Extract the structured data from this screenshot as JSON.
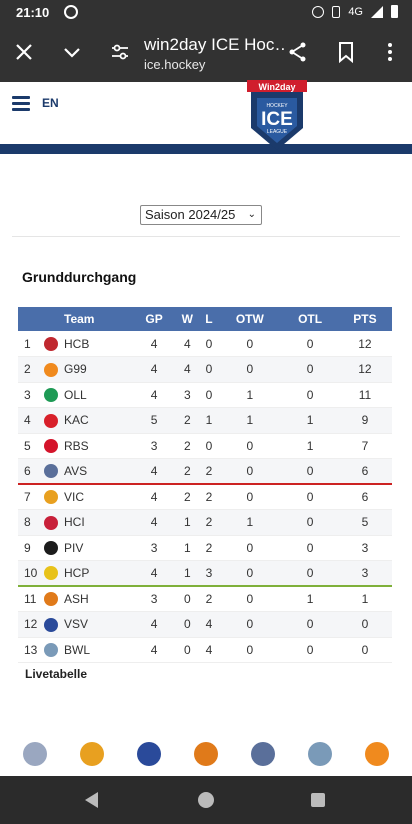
{
  "status_bar": {
    "time": "21:10",
    "network": "4G"
  },
  "browser": {
    "title": "win2day ICE Hoc…",
    "url": "ice.hockey",
    "icons": [
      "close-icon",
      "chevron-down-icon",
      "tune-icon",
      "share-icon",
      "bookmark-icon",
      "more-vert-icon"
    ]
  },
  "site": {
    "lang": "EN",
    "logo_top": "Win2day",
    "logo_sub1": "HOCKEY",
    "logo_main": "ICE",
    "logo_sub2": "LEAGUE"
  },
  "season_select": {
    "value": "Saison 2024/25"
  },
  "section_title": "Grunddurchgang",
  "table": {
    "headers": [
      "Team",
      "GP",
      "W",
      "L",
      "OTW",
      "OTL",
      "PTS"
    ],
    "rows": [
      {
        "pos": "1",
        "team": "HCB",
        "gp": "4",
        "w": "4",
        "l": "0",
        "otw": "0",
        "otl": "0",
        "pts": "12",
        "color": "#c0282f"
      },
      {
        "pos": "2",
        "team": "G99",
        "gp": "4",
        "w": "4",
        "l": "0",
        "otw": "0",
        "otl": "0",
        "pts": "12",
        "color": "#f08a1e"
      },
      {
        "pos": "3",
        "team": "OLL",
        "gp": "4",
        "w": "3",
        "l": "0",
        "otw": "1",
        "otl": "0",
        "pts": "11",
        "color": "#1e9a55"
      },
      {
        "pos": "4",
        "team": "KAC",
        "gp": "5",
        "w": "2",
        "l": "1",
        "otw": "1",
        "otl": "1",
        "pts": "9",
        "color": "#d8202a"
      },
      {
        "pos": "5",
        "team": "RBS",
        "gp": "3",
        "w": "2",
        "l": "0",
        "otw": "0",
        "otl": "1",
        "pts": "7",
        "color": "#d4142b"
      },
      {
        "pos": "6",
        "team": "AVS",
        "gp": "4",
        "w": "2",
        "l": "2",
        "otw": "0",
        "otl": "0",
        "pts": "6",
        "color": "#5a6f9a"
      },
      {
        "pos": "7",
        "team": "VIC",
        "gp": "4",
        "w": "2",
        "l": "2",
        "otw": "0",
        "otl": "0",
        "pts": "6",
        "color": "#e8a020"
      },
      {
        "pos": "8",
        "team": "HCI",
        "gp": "4",
        "w": "1",
        "l": "2",
        "otw": "1",
        "otl": "0",
        "pts": "5",
        "color": "#c8203a"
      },
      {
        "pos": "9",
        "team": "PIV",
        "gp": "3",
        "w": "1",
        "l": "2",
        "otw": "0",
        "otl": "0",
        "pts": "3",
        "color": "#1c1c1c"
      },
      {
        "pos": "10",
        "team": "HCP",
        "gp": "4",
        "w": "1",
        "l": "3",
        "otw": "0",
        "otl": "0",
        "pts": "3",
        "color": "#e8c21a"
      },
      {
        "pos": "11",
        "team": "ASH",
        "gp": "3",
        "w": "0",
        "l": "2",
        "otw": "0",
        "otl": "1",
        "pts": "1",
        "color": "#e07a1a"
      },
      {
        "pos": "12",
        "team": "VSV",
        "gp": "4",
        "w": "0",
        "l": "4",
        "otw": "0",
        "otl": "0",
        "pts": "0",
        "color": "#2a4a9a"
      },
      {
        "pos": "13",
        "team": "BWL",
        "gp": "4",
        "w": "0",
        "l": "4",
        "otw": "0",
        "otl": "0",
        "pts": "0",
        "color": "#7a9ab8"
      }
    ]
  },
  "live_link": "Livetabelle",
  "team_logos_bar": [
    {
      "name": "hci-logo",
      "color": "#9aa7c0"
    },
    {
      "name": "vic-logo",
      "color": "#e8a020"
    },
    {
      "name": "vsv-logo",
      "color": "#2a4a9a"
    },
    {
      "name": "ash-logo",
      "color": "#e07a1a"
    },
    {
      "name": "avs-logo",
      "color": "#5a6f9a"
    },
    {
      "name": "bwl-logo",
      "color": "#7a9ab8"
    },
    {
      "name": "g99-logo",
      "color": "#f08a1e"
    }
  ],
  "colors": {
    "header_blue": "#4a6eaa",
    "brand_navy": "#1b3a6b",
    "playoff_line": "#cc2222",
    "prequal_line": "#7fb03a"
  }
}
